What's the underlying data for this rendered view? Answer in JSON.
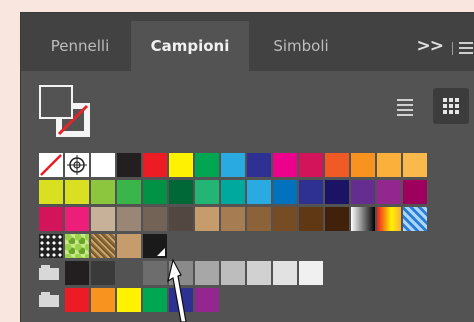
{
  "tabs": [
    {
      "label": "Pennelli",
      "active": false
    },
    {
      "label": "Campioni",
      "active": true
    },
    {
      "label": "Simboli",
      "active": false
    }
  ],
  "tab_overflow_label": ">>",
  "icons": {
    "overflow": "chevron-double-right-icon",
    "menu": "hamburger-menu-icon",
    "list": "list-view-icon",
    "grid": "grid-view-icon",
    "none_swatch": "none-swatch-icon",
    "registration": "registration-mark-icon",
    "folder": "folder-icon",
    "cursor": "mouse-pointer-icon"
  },
  "fill_color": "#535353",
  "stroke_color": "none",
  "swatch_rows": [
    {
      "type": "colors",
      "colors": [
        "none",
        "registration",
        "#ffffff",
        "#231f20",
        "#ed1c24",
        "#fff200",
        "#00a651",
        "#29abe2",
        "#2e3192",
        "#ec008c",
        "#d4145a",
        "#f15a24",
        "#f7931e",
        "#fbb03b",
        "#f9b94b"
      ]
    },
    {
      "type": "colors",
      "colors": [
        "#d9e021",
        "#d9e021",
        "#8cc63f",
        "#39b54a",
        "#009245",
        "#006837",
        "#22b573",
        "#00a99d",
        "#29abe2",
        "#0071bc",
        "#2e3192",
        "#1b1464",
        "#662d91",
        "#93278f",
        "#9e005d"
      ]
    },
    {
      "type": "colors",
      "colors": [
        "#d4145a",
        "#ed1e79",
        "#c7b299",
        "#998675",
        "#736357",
        "#534741",
        "#c69c6d",
        "#a67c52",
        "#8c6239",
        "#754c24",
        "#603813",
        "#42210b",
        "gradient-bw",
        "gradient-yellow",
        "gradient-blue"
      ]
    },
    {
      "type": "patterns",
      "colors": [
        "pattern-dots",
        "pattern-leaves",
        "pattern-texture",
        "#c69c6d",
        "#1a1a1a"
      ]
    },
    {
      "type": "group",
      "colors": [
        "#231f20",
        "#3a3a3a",
        "#535353",
        "#6d6d6d",
        "#8a8a8a",
        "#a7a7a7",
        "#bdbdbd",
        "#d1d1d1",
        "#e2e2e2",
        "#f0f0f0"
      ]
    },
    {
      "type": "group",
      "colors": [
        "#ed1c24",
        "#f7931e",
        "#fff200",
        "#00a651",
        "#2e3192",
        "#93278f"
      ]
    }
  ]
}
